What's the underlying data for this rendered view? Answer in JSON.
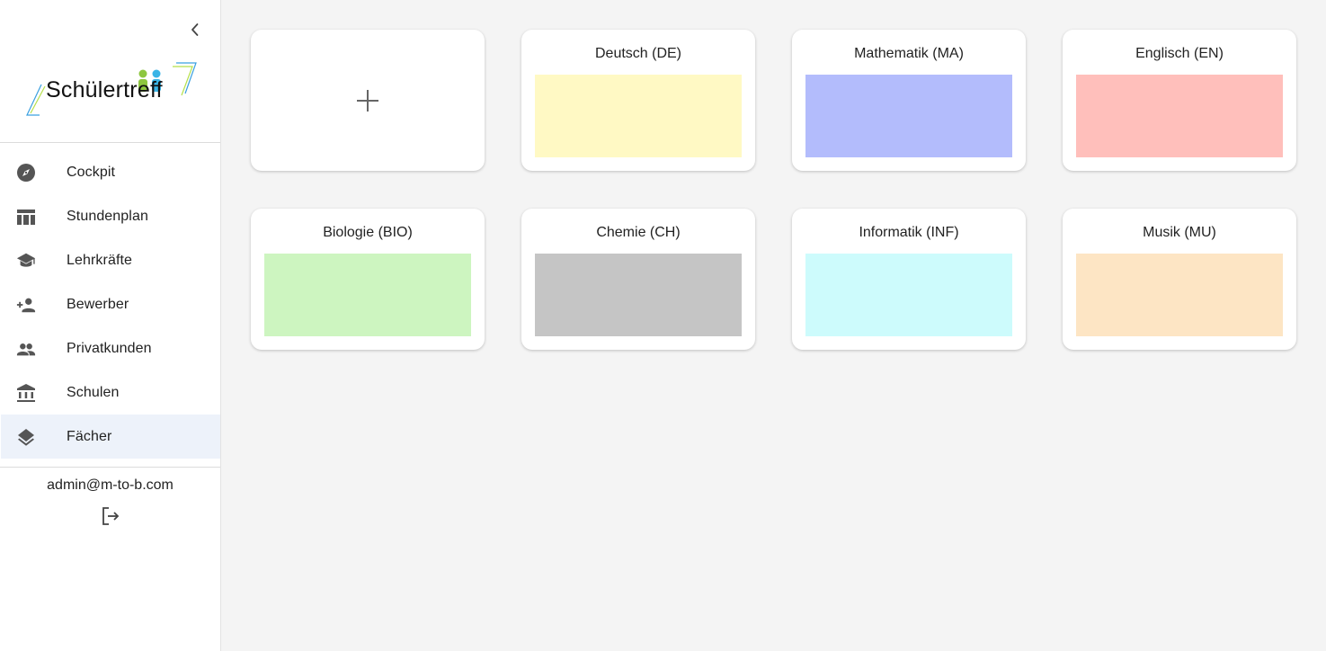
{
  "sidebar": {
    "logo_text": "Schülertreff",
    "nav_items": [
      {
        "label": "Cockpit",
        "icon": "compass-icon",
        "active": false
      },
      {
        "label": "Stundenplan",
        "icon": "table-icon",
        "active": false
      },
      {
        "label": "Lehrkräfte",
        "icon": "school-cap-icon",
        "active": false
      },
      {
        "label": "Bewerber",
        "icon": "person-add-icon",
        "active": false
      },
      {
        "label": "Privatkunden",
        "icon": "people-icon",
        "active": false
      },
      {
        "label": "Schulen",
        "icon": "institution-icon",
        "active": false
      },
      {
        "label": "Fächer",
        "icon": "layers-icon",
        "active": true
      }
    ],
    "user_email": "admin@m-to-b.com",
    "active_bg": "#edf2fa"
  },
  "main": {
    "add_card": {
      "icon": "plus-icon"
    },
    "subjects": [
      {
        "name": "Deutsch (DE)",
        "color": "#fff9c4"
      },
      {
        "name": "Mathematik (MA)",
        "color": "#b3bcfc"
      },
      {
        "name": "Englisch (EN)",
        "color": "#ffbfbb"
      },
      {
        "name": "Biologie (BIO)",
        "color": "#cdf5c0"
      },
      {
        "name": "Chemie (CH)",
        "color": "#c5c5c5"
      },
      {
        "name": "Informatik (INF)",
        "color": "#cdfbfc"
      },
      {
        "name": "Musik (MU)",
        "color": "#fde5c4"
      }
    ]
  }
}
